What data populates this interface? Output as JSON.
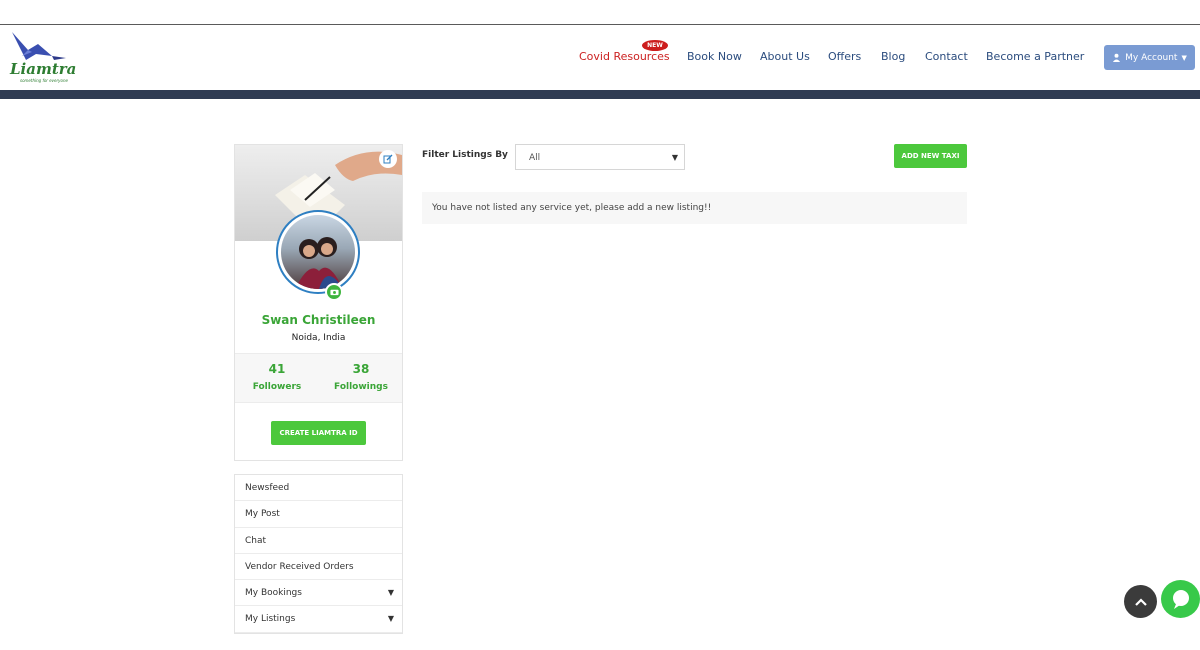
{
  "header": {
    "logo_text": "Liamtra",
    "logo_tagline": "something for everyone",
    "nav": [
      {
        "label": "Covid Resources",
        "badge": "NEW"
      },
      {
        "label": "Book Now"
      },
      {
        "label": "About Us"
      },
      {
        "label": "Offers"
      },
      {
        "label": "Blog"
      },
      {
        "label": "Contact"
      },
      {
        "label": "Become a Partner"
      }
    ],
    "account_label": "My Account"
  },
  "profile": {
    "name": "Swan Christileen",
    "location": "Noida, India",
    "followers_count": "41",
    "followers_label": "Followers",
    "followings_count": "38",
    "followings_label": "Followings",
    "create_button": "CREATE LIAMTRA ID"
  },
  "menu": [
    {
      "label": "Newsfeed"
    },
    {
      "label": "My Post"
    },
    {
      "label": "Chat"
    },
    {
      "label": "Vendor Received Orders"
    },
    {
      "label": "My Bookings",
      "expandable": true
    },
    {
      "label": "My Listings",
      "expandable": true
    }
  ],
  "listings": {
    "filter_label": "Filter Listings By",
    "filter_value": "All",
    "add_button": "ADD NEW TAXI",
    "empty_message": "You have not listed any service yet, please add a new listing!!"
  },
  "colors": {
    "accent_green": "#4cc83c",
    "nav_blue": "#2b4c7e",
    "covid_red": "#cc2222",
    "dark_band": "#2f3b52"
  }
}
